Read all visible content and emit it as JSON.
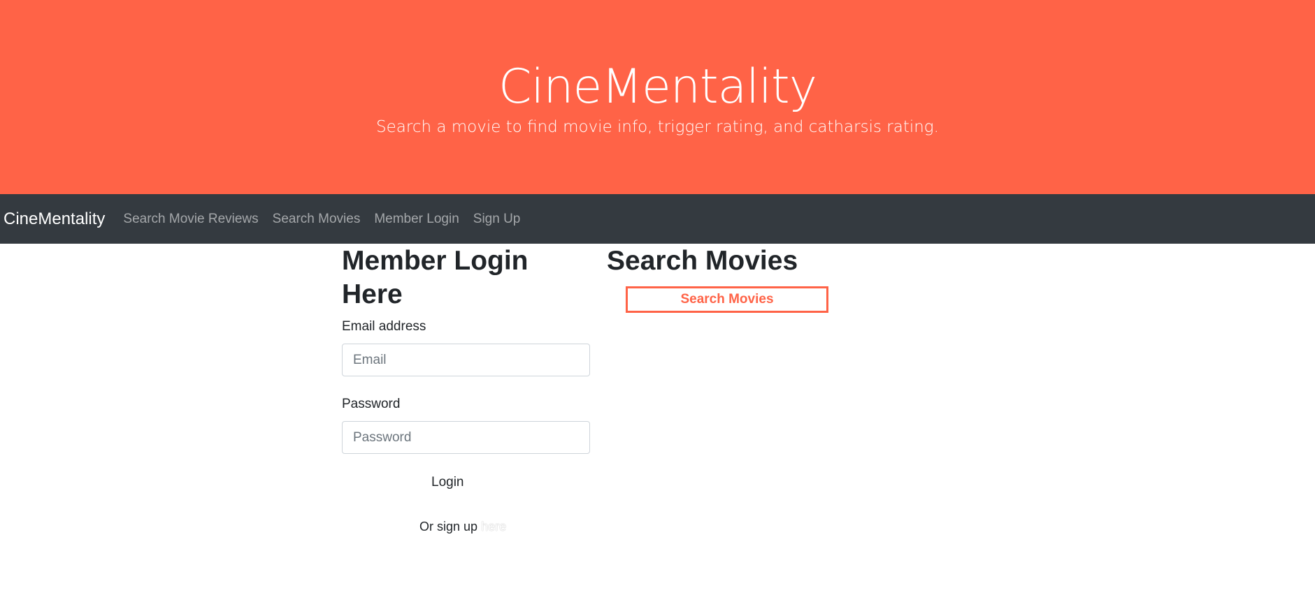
{
  "hero": {
    "title": "CineMentality",
    "subtitle": "Search a movie to find movie info, trigger rating, and catharsis rating."
  },
  "navbar": {
    "brand": "CineMentality",
    "links": [
      "Search Movie Reviews",
      "Search Movies",
      "Member Login",
      "Sign Up"
    ]
  },
  "login": {
    "title": "Member Login Here",
    "email_label": "Email address",
    "email_placeholder": "Email",
    "password_label": "Password",
    "password_placeholder": "Password",
    "submit_label": "Login",
    "signup_prefix": "Or sign up",
    "signup_link": "here"
  },
  "search": {
    "title": "Search Movies",
    "button_label": "Search Movies"
  },
  "colors": {
    "hero_bg": "#ff6347",
    "navbar_bg": "#343a40",
    "accent": "#ff6347"
  }
}
